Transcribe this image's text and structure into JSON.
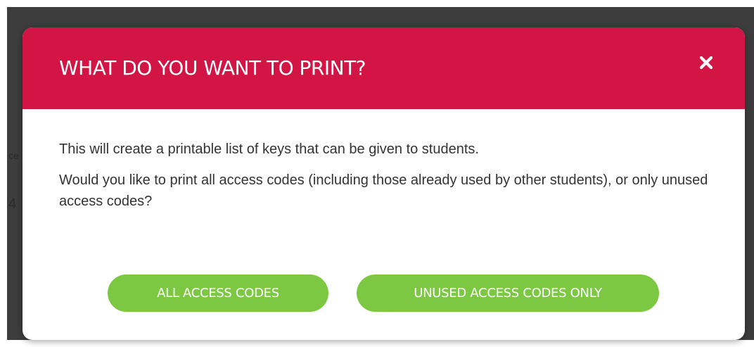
{
  "background": {
    "glimpse_top": "ce",
    "glimpse_mid": "4"
  },
  "modal": {
    "title": "WHAT DO YOU WANT TO PRINT?",
    "close_icon": "close-icon",
    "paragraphs": [
      "This will create a printable list of keys that can be given to students.",
      "Would you like to print all access codes (including those already used by other students), or only unused access codes?"
    ],
    "buttons": {
      "all_label": "ALL ACCESS CODES",
      "unused_label": "UNUSED ACCESS CODES ONLY"
    }
  },
  "colors": {
    "header": "#d31545",
    "button": "#7dc843",
    "backdrop": "#3d3d3d"
  }
}
